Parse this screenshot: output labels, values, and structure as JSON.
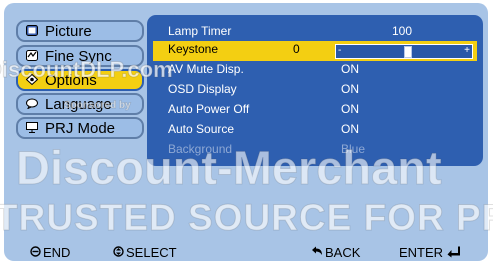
{
  "sidebar": {
    "tabs": [
      {
        "label": "Picture",
        "icon": "picture-icon"
      },
      {
        "label": "Fine Sync",
        "icon": "fine-sync-icon"
      },
      {
        "label": "Options",
        "icon": "options-icon",
        "active": true
      },
      {
        "label": "Language",
        "icon": "language-icon"
      },
      {
        "label": "PRJ Mode",
        "icon": "prj-mode-icon"
      }
    ]
  },
  "options_menu": {
    "rows": [
      {
        "label": "Lamp Timer",
        "value": "100"
      },
      {
        "label": "Keystone",
        "value": "0",
        "selected": true
      },
      {
        "label": "AV Mute Disp.",
        "value": "ON"
      },
      {
        "label": "OSD Display",
        "value": "ON"
      },
      {
        "label": "Auto Power Off",
        "value": "ON"
      },
      {
        "label": "Auto Source",
        "value": "ON"
      },
      {
        "label": "Background",
        "value": "Blue",
        "disabled": true
      }
    ],
    "keystone_slider": {
      "min_label": "-",
      "max_label": "+",
      "level": 0.5
    }
  },
  "footer": {
    "end": "END",
    "select": "SELECT",
    "back": "BACK",
    "enter": "ENTER"
  },
  "watermark": {
    "site": "DiscountDLP.com",
    "sponsored": "Sponsored by",
    "brand": "Discount-Merchant",
    "tagline": "TRUSTED SOURCE FOR PROJECTOR"
  },
  "colors": {
    "osd_background": "#a8c4e6",
    "menu_panel": "#2e5fb0",
    "highlight": "#f3cf12",
    "text_light": "#ffffff",
    "text_dim": "#8ea8d4"
  }
}
